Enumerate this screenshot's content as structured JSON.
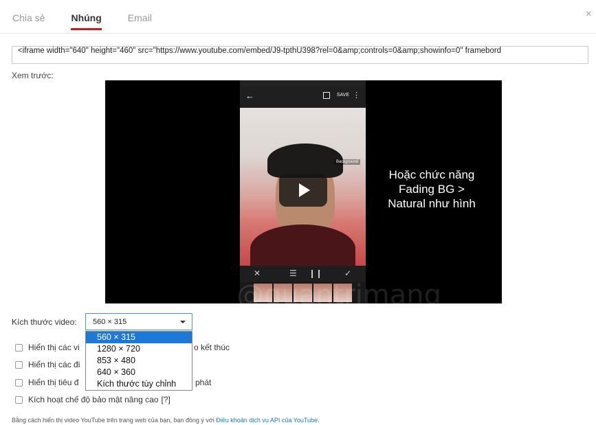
{
  "tabs": [
    {
      "label": "Chia sẻ",
      "active": false
    },
    {
      "label": "Nhúng",
      "active": true
    },
    {
      "label": "Email",
      "active": false
    }
  ],
  "close_label": "×",
  "embed_code": "<iframe width=\"640\" height=\"460\" src=\"https://www.youtube.com/embed/J9-tpthU398?rel=0&amp;controls=0&amp;showinfo=0\" framebord",
  "preview_label": "Xem trước:",
  "video": {
    "overlay_lines": [
      "Hoặc chức năng",
      "Fading BG >",
      "Natural như hình"
    ],
    "phone_save_label": "SAVE",
    "phone_bg_tag": "Background",
    "watermark": "@quantrimang"
  },
  "size": {
    "label": "Kích thước video:",
    "selected": "560 × 315",
    "options": [
      "560 × 315",
      "1280 × 720",
      "853 × 480",
      "640 × 360",
      "Kích thước tùy chỉnh"
    ]
  },
  "checkboxes": [
    {
      "visible_prefix": "Hiển thị các vi",
      "visible_suffix": "o kết thúc"
    },
    {
      "visible_prefix": "Hiển thị các đi",
      "visible_suffix": ""
    },
    {
      "visible_prefix": "Hiển thị tiêu đ",
      "visible_suffix": "phát"
    },
    {
      "visible_prefix": "Kích hoạt chế độ bảo mật nâng cao",
      "help": "[?]"
    }
  ],
  "footer": {
    "text": "Bằng cách hiển thị video YouTube trên trang web của bạn, bạn đồng ý với ",
    "link": "Điều khoản dịch vụ API của YouTube",
    "end": "."
  },
  "colors": {
    "accent_red": "#cc181e",
    "select_blue": "#1e78d7",
    "link_blue": "#167ac6"
  }
}
